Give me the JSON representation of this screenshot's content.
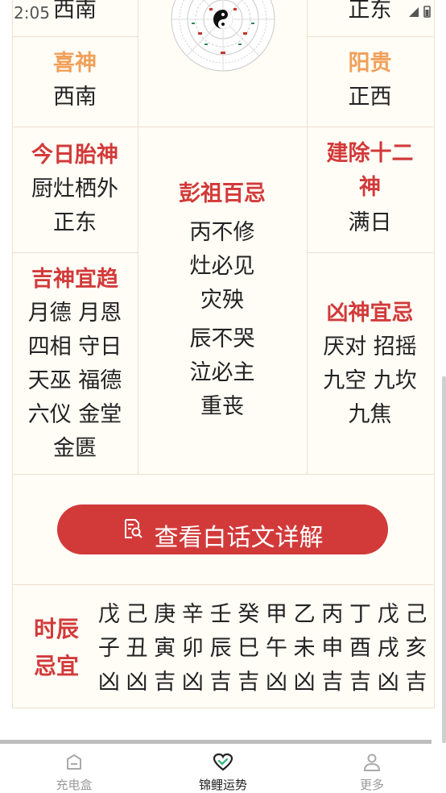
{
  "status": {
    "time": "2:05"
  },
  "top_row": {
    "left": "西南",
    "right": "正东"
  },
  "xishen": {
    "title": "喜神",
    "value": "西南"
  },
  "yanggui": {
    "title": "阳贵",
    "value": "正西"
  },
  "taishen": {
    "title": "今日胎神",
    "lines": [
      "厨灶栖外",
      "正东"
    ]
  },
  "pengzu": {
    "title": "彭祖百忌",
    "lines": [
      "丙不修",
      "灶必见",
      "灾殃",
      "辰不哭",
      "泣必主",
      "重丧"
    ]
  },
  "jianchu": {
    "title_lines": [
      "建除十二",
      "神"
    ],
    "value": "满日"
  },
  "jishen": {
    "title": "吉神宜趋",
    "lines": [
      "月德 月恩",
      "四相 守日",
      "天巫 福德",
      "六仪 金堂",
      "金匮"
    ]
  },
  "xiongshen": {
    "title": "凶神宜忌",
    "lines": [
      "厌对 招摇",
      "九空 九坎",
      "九焦"
    ]
  },
  "detail_button": {
    "label": "查看白话文详解",
    "icon": "document-search-icon"
  },
  "shichen": {
    "title_lines": [
      "时辰",
      "忌宜"
    ],
    "stems": [
      "戊",
      "己",
      "庚",
      "辛",
      "壬",
      "癸",
      "甲",
      "乙",
      "丙",
      "丁",
      "戊",
      "己"
    ],
    "branches": [
      "子",
      "丑",
      "寅",
      "卯",
      "辰",
      "巳",
      "午",
      "未",
      "申",
      "酉",
      "戌",
      "亥"
    ],
    "fortunes": [
      "凶",
      "凶",
      "吉",
      "凶",
      "吉",
      "吉",
      "凶",
      "凶",
      "吉",
      "吉",
      "凶",
      "吉"
    ]
  },
  "tabs": [
    {
      "label": "充电盒",
      "icon": "box-icon",
      "active": false
    },
    {
      "label": "锦鲤运势",
      "icon": "heart-icon",
      "active": true
    },
    {
      "label": "更多",
      "icon": "person-icon",
      "active": false
    }
  ],
  "colors": {
    "accent_red": "#d23a3a",
    "accent_orange": "#f0a05a",
    "text": "#222222",
    "tab_inactive": "#9a9a9a"
  }
}
